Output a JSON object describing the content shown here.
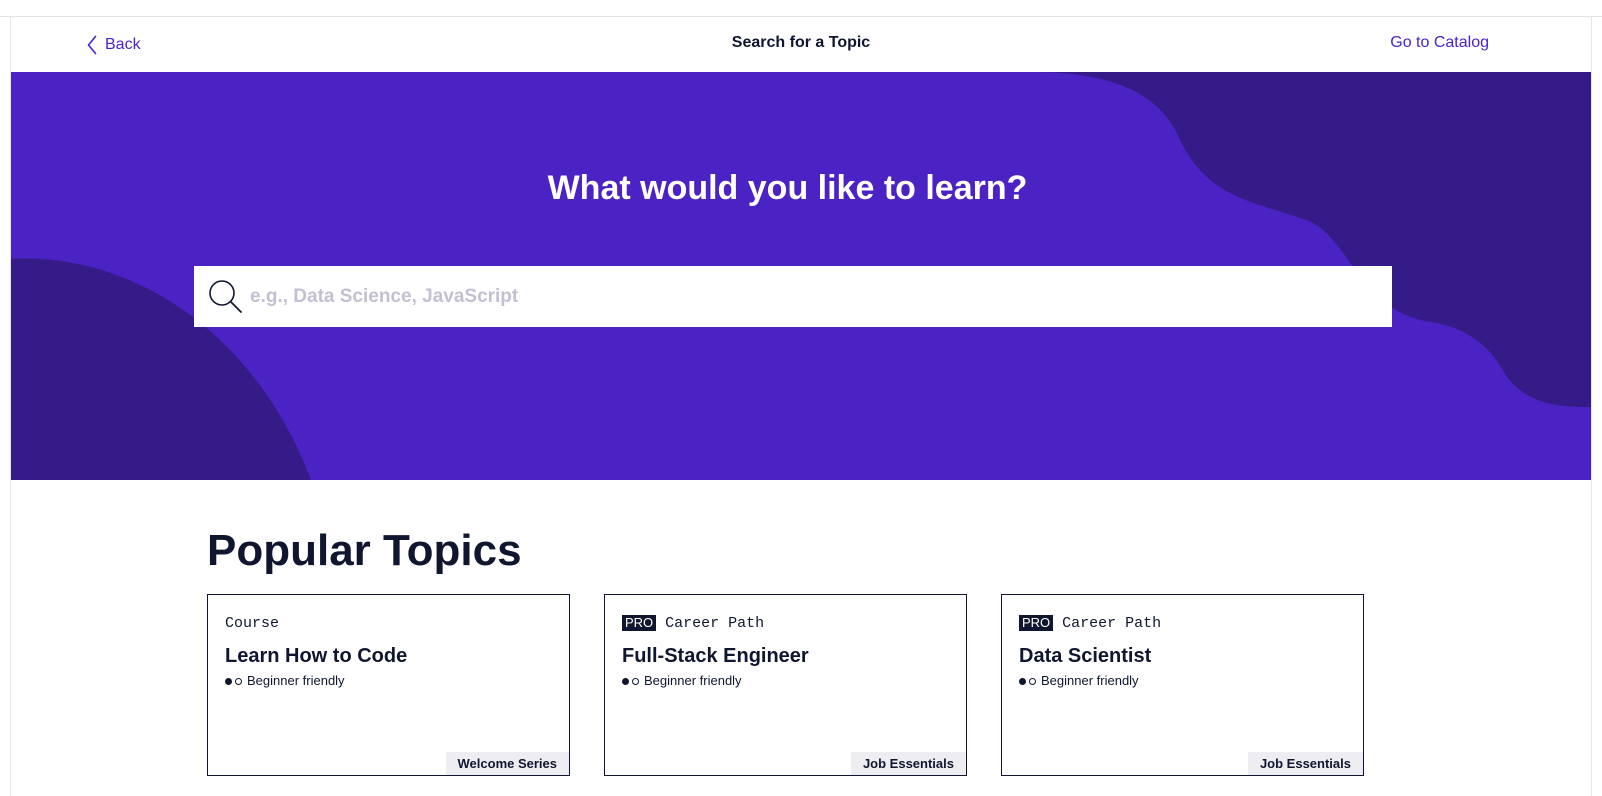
{
  "header": {
    "back_label": "Back",
    "title": "Search for a Topic",
    "catalog_label": "Go to Catalog"
  },
  "hero": {
    "heading": "What would you like to learn?",
    "search": {
      "placeholder": "e.g., Data Science, JavaScript",
      "value": ""
    }
  },
  "popular": {
    "heading": "Popular Topics",
    "cards": [
      {
        "pro": "",
        "type": "Course",
        "title": "Learn How to Code",
        "level": "Beginner friendly",
        "tag": "Welcome Series"
      },
      {
        "pro": "PRO",
        "type": "Career Path",
        "title": "Full-Stack Engineer",
        "level": "Beginner friendly",
        "tag": "Job Essentials"
      },
      {
        "pro": "PRO",
        "type": "Career Path",
        "title": "Data Scientist",
        "level": "Beginner friendly",
        "tag": "Job Essentials"
      }
    ]
  },
  "colors": {
    "accent": "#4b23c8",
    "hero_background": "#4b22c4",
    "hero_shape": "#351b87",
    "text_dark": "#10162f"
  },
  "icons": {
    "back": "chevron-left-icon",
    "search": "search-icon",
    "level": "difficulty-dots-icon"
  }
}
